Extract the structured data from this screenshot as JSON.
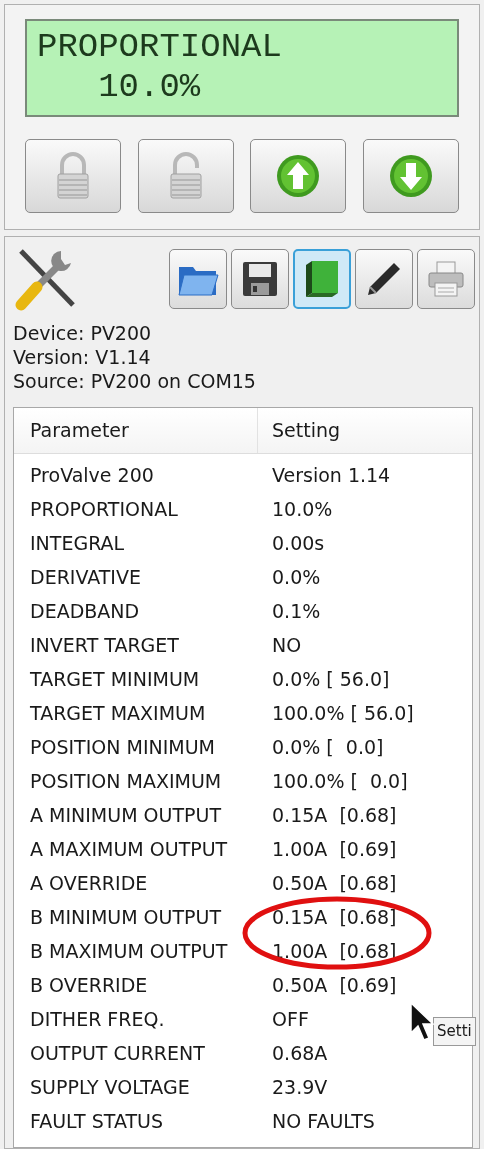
{
  "display": {
    "line_1": "PROPORTIONAL",
    "line_2": "   10.0%"
  },
  "control_buttons": [
    {
      "kind": "lock"
    },
    {
      "kind": "unlock"
    },
    {
      "kind": "up"
    },
    {
      "kind": "down"
    }
  ],
  "toolbar": [
    {
      "kind": "open",
      "selected": false
    },
    {
      "kind": "save",
      "selected": false
    },
    {
      "kind": "book",
      "selected": true
    },
    {
      "kind": "edit",
      "selected": false
    },
    {
      "kind": "print",
      "selected": false
    }
  ],
  "info": [
    "Device: PV200",
    "Version: V1.14",
    "Source: PV200 on COM15"
  ],
  "table": {
    "columns": [
      "Parameter",
      "Setting"
    ],
    "rows": [
      {
        "parameter": "ProValve 200",
        "setting": "Version 1.14"
      },
      {
        "parameter": "PROPORTIONAL",
        "setting": "10.0%"
      },
      {
        "parameter": "INTEGRAL",
        "setting": "0.00s"
      },
      {
        "parameter": "DERIVATIVE",
        "setting": "0.0%"
      },
      {
        "parameter": "DEADBAND",
        "setting": "0.1%"
      },
      {
        "parameter": "INVERT TARGET",
        "setting": "NO"
      },
      {
        "parameter": "TARGET MINIMUM",
        "setting": "0.0% [ 56.0]"
      },
      {
        "parameter": "TARGET MAXIMUM",
        "setting": "100.0% [ 56.0]"
      },
      {
        "parameter": "POSITION MINIMUM",
        "setting": "0.0% [  0.0]"
      },
      {
        "parameter": "POSITION MAXIMUM",
        "setting": "100.0% [  0.0]"
      },
      {
        "parameter": "A MINIMUM OUTPUT",
        "setting": "0.15A  [0.68]"
      },
      {
        "parameter": "A MAXIMUM OUTPUT",
        "setting": "1.00A  [0.69]"
      },
      {
        "parameter": "A OVERRIDE",
        "setting": "0.50A  [0.68]"
      },
      {
        "parameter": "B MINIMUM OUTPUT",
        "setting": "0.15A  [0.68]"
      },
      {
        "parameter": "B MAXIMUM OUTPUT",
        "setting": "1.00A  [0.68]"
      },
      {
        "parameter": "B OVERRIDE",
        "setting": "0.50A  [0.69]"
      },
      {
        "parameter": "DITHER FREQ.",
        "setting": "OFF"
      },
      {
        "parameter": "OUTPUT CURRENT",
        "setting": "0.68A"
      },
      {
        "parameter": "SUPPLY VOLTAGE",
        "setting": "23.9V"
      },
      {
        "parameter": "FAULT STATUS",
        "setting": "NO FAULTS"
      }
    ]
  },
  "tooltip": "Setti"
}
